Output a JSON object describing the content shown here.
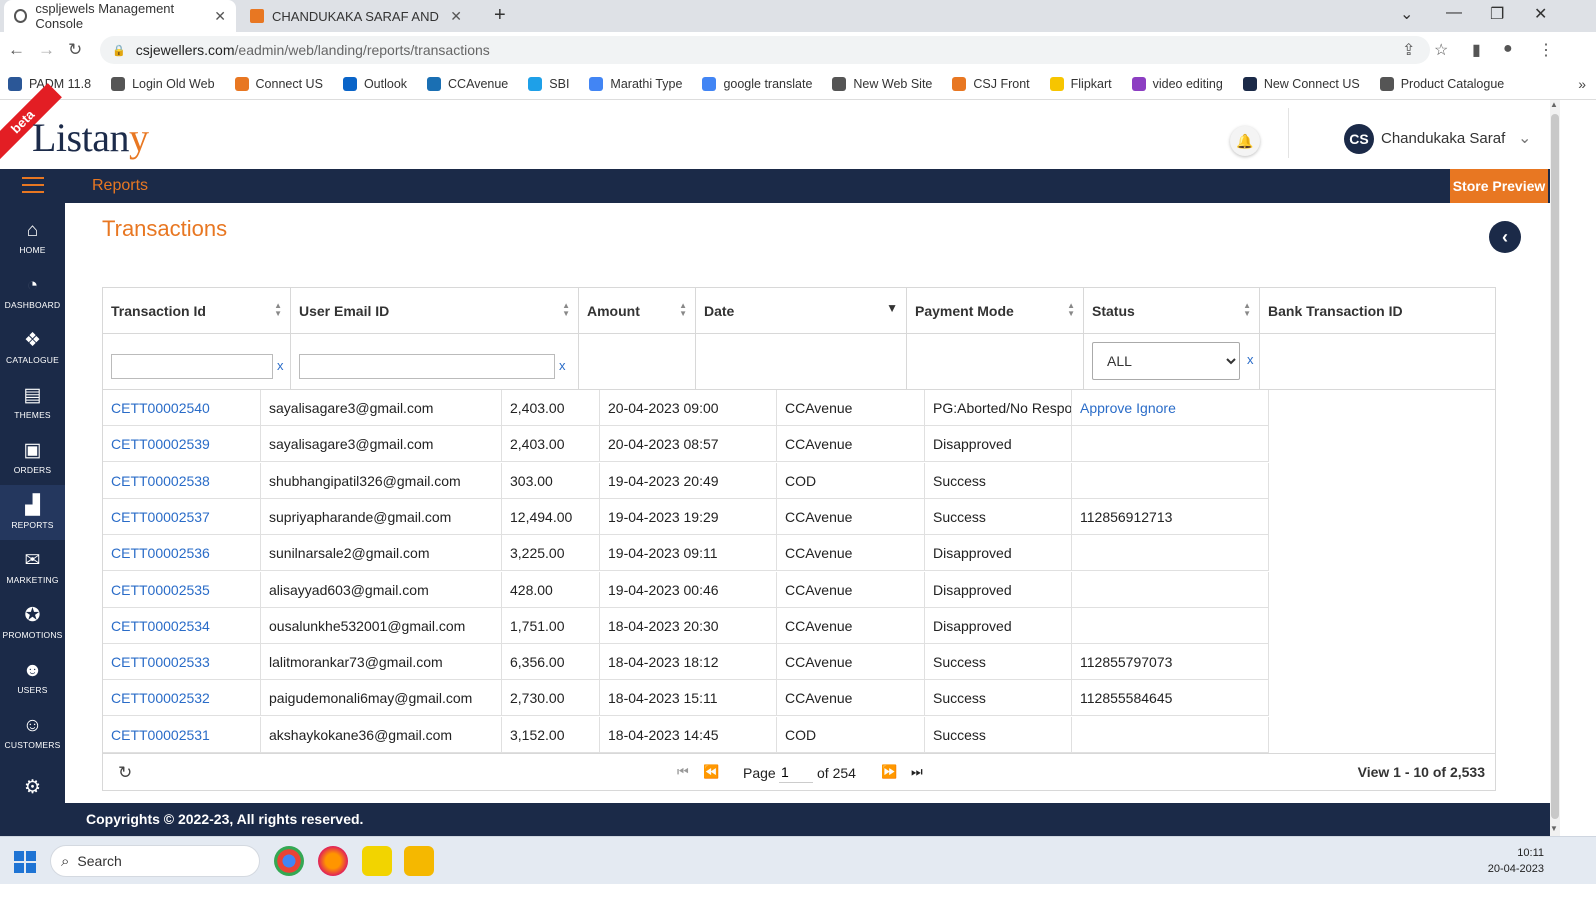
{
  "browser": {
    "tabs": [
      {
        "title": "cspljewels Management Console",
        "active": true
      },
      {
        "title": "CHANDUKAKA SARAF AND SON",
        "active": false
      }
    ],
    "url_host": "csjewellers.com",
    "url_path": "/eadmin/web/landing/reports/transactions",
    "bookmarks": [
      {
        "label": "PADM 11.8",
        "color": "#2b5797"
      },
      {
        "label": "Login Old Web",
        "color": "#555555"
      },
      {
        "label": "Connect US",
        "color": "#e87722"
      },
      {
        "label": "Outlook",
        "color": "#0a64c8"
      },
      {
        "label": "CCAvenue",
        "color": "#1a6fb3"
      },
      {
        "label": "SBI",
        "color": "#1ea0e8"
      },
      {
        "label": "Marathi Type",
        "color": "#4285f4"
      },
      {
        "label": "google translate",
        "color": "#4285f4"
      },
      {
        "label": "New Web Site",
        "color": "#555555"
      },
      {
        "label": "CSJ Front",
        "color": "#e87722"
      },
      {
        "label": "Flipkart",
        "color": "#f7c500"
      },
      {
        "label": "video editing",
        "color": "#8c3ec2"
      },
      {
        "label": "New Connect US",
        "color": "#1b2a48"
      },
      {
        "label": "Product Catalogue",
        "color": "#555555"
      }
    ]
  },
  "header": {
    "beta": "beta",
    "logo_main": "Listan",
    "logo_tail": "y",
    "avatar_initials": "CS",
    "user_name": "Chandukaka Saraf"
  },
  "navbar": {
    "title": "Reports",
    "store_preview": "Store Preview"
  },
  "sidebar": {
    "items": [
      {
        "label": "HOME",
        "icon": "⌂"
      },
      {
        "label": "DASHBOARD",
        "icon": "◔"
      },
      {
        "label": "CATALOGUE",
        "icon": "❖"
      },
      {
        "label": "THEMES",
        "icon": "▤"
      },
      {
        "label": "ORDERS",
        "icon": "▣"
      },
      {
        "label": "REPORTS",
        "icon": "▟",
        "active": true
      },
      {
        "label": "MARKETING",
        "icon": "✉"
      },
      {
        "label": "PROMOTIONS",
        "icon": "✪"
      },
      {
        "label": "USERS",
        "icon": "☻"
      },
      {
        "label": "CUSTOMERS",
        "icon": "☺"
      },
      {
        "label": "",
        "icon": "⚙"
      }
    ]
  },
  "page": {
    "title": "Transactions"
  },
  "grid": {
    "columns": [
      "Transaction Id",
      "User Email ID",
      "Amount",
      "Date",
      "Payment Mode",
      "Status",
      "Bank Transaction ID"
    ],
    "filter_clear": "x",
    "status_filter": {
      "selected": "ALL",
      "options": [
        "ALL"
      ]
    },
    "rows": [
      {
        "id": "CETT00002540",
        "email": "sayalisagare3@gmail.com",
        "amount": "2,403.00",
        "date": "20-04-2023 09:00",
        "mode": "CCAvenue",
        "status": "PG:Aborted/No Response",
        "bank": "",
        "approve": "Approve",
        "ignore": "Ignore"
      },
      {
        "id": "CETT00002539",
        "email": "sayalisagare3@gmail.com",
        "amount": "2,403.00",
        "date": "20-04-2023 08:57",
        "mode": "CCAvenue",
        "status": "Disapproved",
        "bank": ""
      },
      {
        "id": "CETT00002538",
        "email": "shubhangipatil326@gmail.com",
        "amount": "303.00",
        "date": "19-04-2023 20:49",
        "mode": "COD",
        "status": "Success",
        "bank": ""
      },
      {
        "id": "CETT00002537",
        "email": "supriyapharande@gmail.com",
        "amount": "12,494.00",
        "date": "19-04-2023 19:29",
        "mode": "CCAvenue",
        "status": "Success",
        "bank": "112856912713"
      },
      {
        "id": "CETT00002536",
        "email": "sunilnarsale2@gmail.com",
        "amount": "3,225.00",
        "date": "19-04-2023 09:11",
        "mode": "CCAvenue",
        "status": "Disapproved",
        "bank": ""
      },
      {
        "id": "CETT00002535",
        "email": "alisayyad603@gmail.com",
        "amount": "428.00",
        "date": "19-04-2023 00:46",
        "mode": "CCAvenue",
        "status": "Disapproved",
        "bank": ""
      },
      {
        "id": "CETT00002534",
        "email": "ousalunkhe532001@gmail.com",
        "amount": "1,751.00",
        "date": "18-04-2023 20:30",
        "mode": "CCAvenue",
        "status": "Disapproved",
        "bank": ""
      },
      {
        "id": "CETT00002533",
        "email": "lalitmorankar73@gmail.com",
        "amount": "6,356.00",
        "date": "18-04-2023 18:12",
        "mode": "CCAvenue",
        "status": "Success",
        "bank": "112855797073"
      },
      {
        "id": "CETT00002532",
        "email": "paigudemonali6may@gmail.com",
        "amount": "2,730.00",
        "date": "18-04-2023 15:11",
        "mode": "CCAvenue",
        "status": "Success",
        "bank": "112855584645"
      },
      {
        "id": "CETT00002531",
        "email": "akshaykokane36@gmail.com",
        "amount": "3,152.00",
        "date": "18-04-2023 14:45",
        "mode": "COD",
        "status": "Success",
        "bank": ""
      }
    ],
    "pager": {
      "page_label": "Page",
      "page_value": "1",
      "of_label": "of 254",
      "view_info": "View 1 - 10 of 2,533"
    }
  },
  "footer": {
    "text": "Copyrights © 2022-23, All rights reserved."
  },
  "taskbar": {
    "search_label": "Search",
    "time": "10:11",
    "date": "20-04-2023"
  },
  "colors": {
    "brand_navy": "#1b2a48",
    "accent_orange": "#e87722",
    "link_blue": "#2a6cc8"
  }
}
